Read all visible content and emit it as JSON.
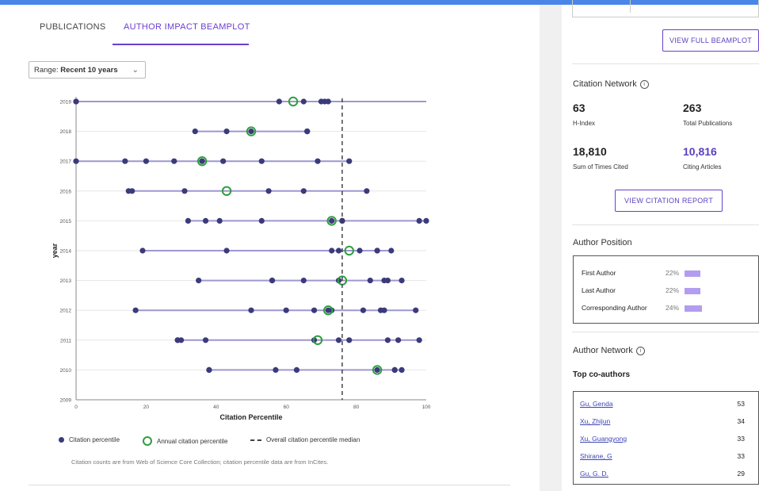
{
  "tabs": {
    "publications": "PUBLICATIONS",
    "author_impact": "AUTHOR IMPACT BEAMPLOT"
  },
  "range": {
    "label": "Range:",
    "value": "Recent 10 years"
  },
  "chart_data": {
    "type": "scatter",
    "xlabel": "Citation Percentile",
    "ylabel": "year",
    "xlim": [
      0,
      100
    ],
    "x_ticks": [
      "0",
      "20",
      "40",
      "60",
      "80",
      "100"
    ],
    "y_ticks": [
      "2019",
      "2018",
      "2017",
      "2016",
      "2015",
      "2014",
      "2013",
      "2012",
      "2011",
      "2010",
      "2009"
    ],
    "median": 76,
    "grid": true,
    "years": [
      {
        "year": "2019",
        "points": [
          0,
          0,
          58,
          65,
          70,
          71,
          72
        ],
        "annual": 62,
        "range": [
          0,
          100
        ]
      },
      {
        "year": "2018",
        "points": [
          34,
          43,
          50,
          66,
          66,
          66
        ],
        "annual": 50,
        "range": [
          34,
          66
        ]
      },
      {
        "year": "2017",
        "points": [
          0,
          14,
          20,
          28,
          36,
          36,
          42,
          53,
          69,
          78
        ],
        "annual": 36,
        "range": [
          0,
          78
        ]
      },
      {
        "year": "2016",
        "points": [
          15,
          16,
          31,
          55,
          65,
          83
        ],
        "annual": 43,
        "range": [
          15,
          83
        ]
      },
      {
        "year": "2015",
        "points": [
          32,
          37,
          41,
          53,
          73,
          76,
          76,
          98,
          100
        ],
        "annual": 73,
        "range": [
          32,
          100
        ]
      },
      {
        "year": "2014",
        "points": [
          19,
          43,
          73,
          75,
          81,
          86,
          86,
          90
        ],
        "annual": 78,
        "range": [
          19,
          90
        ]
      },
      {
        "year": "2013",
        "points": [
          35,
          56,
          56,
          65,
          75,
          84,
          88,
          89,
          93
        ],
        "annual": 76,
        "range": [
          35,
          93
        ]
      },
      {
        "year": "2012",
        "points": [
          17,
          50,
          60,
          68,
          72,
          73,
          82,
          87,
          88,
          97
        ],
        "annual": 72,
        "range": [
          17,
          97
        ]
      },
      {
        "year": "2011",
        "points": [
          29,
          29,
          30,
          37,
          68,
          75,
          78,
          89,
          92,
          98
        ],
        "annual": 69,
        "range": [
          29,
          98
        ]
      },
      {
        "year": "2010",
        "points": [
          38,
          38,
          57,
          63,
          86,
          91,
          91,
          93
        ],
        "annual": 86,
        "range": [
          38,
          93
        ]
      }
    ]
  },
  "legend": {
    "citation_percentile": "Citation percentile",
    "annual": "Annual citation percentile",
    "median": "Overall citation percentile median"
  },
  "source_note": "Citation counts are from Web of Science Core Collection; citation percentile data are from InCites.",
  "buttons": {
    "view_beamplot": "VIEW FULL BEAMPLOT",
    "view_report": "VIEW CITATION REPORT"
  },
  "citation_network": {
    "title": "Citation Network",
    "h_index": {
      "value": "63",
      "label": "H-Index"
    },
    "total_pubs": {
      "value": "263",
      "label": "Total Publications"
    },
    "times_cited": {
      "value": "18,810",
      "label": "Sum of Times Cited"
    },
    "citing_articles": {
      "value": "10,816",
      "label": "Citing Articles"
    }
  },
  "author_position": {
    "title": "Author Position",
    "rows": [
      {
        "label": "First Author",
        "pct": "22%",
        "value": 22
      },
      {
        "label": "Last Author",
        "pct": "22%",
        "value": 22
      },
      {
        "label": "Corresponding Author",
        "pct": "24%",
        "value": 24
      }
    ]
  },
  "author_network": {
    "title": "Author Network",
    "top_coauthors": "Top co-authors",
    "rows": [
      {
        "name": "Gu, Genda",
        "count": "53"
      },
      {
        "name": "Xu, Zhijun",
        "count": "34"
      },
      {
        "name": "Xu, Guangyong",
        "count": "33"
      },
      {
        "name": "Shirane, G",
        "count": "33"
      },
      {
        "name": "Gu, G. D.",
        "count": "29"
      }
    ]
  },
  "colors": {
    "accent": "#6a3fd0",
    "dot": "#3b3a7a",
    "ring": "#2e9e3e",
    "beam": "#9d97cf",
    "pos_bar": "#b39df0"
  }
}
